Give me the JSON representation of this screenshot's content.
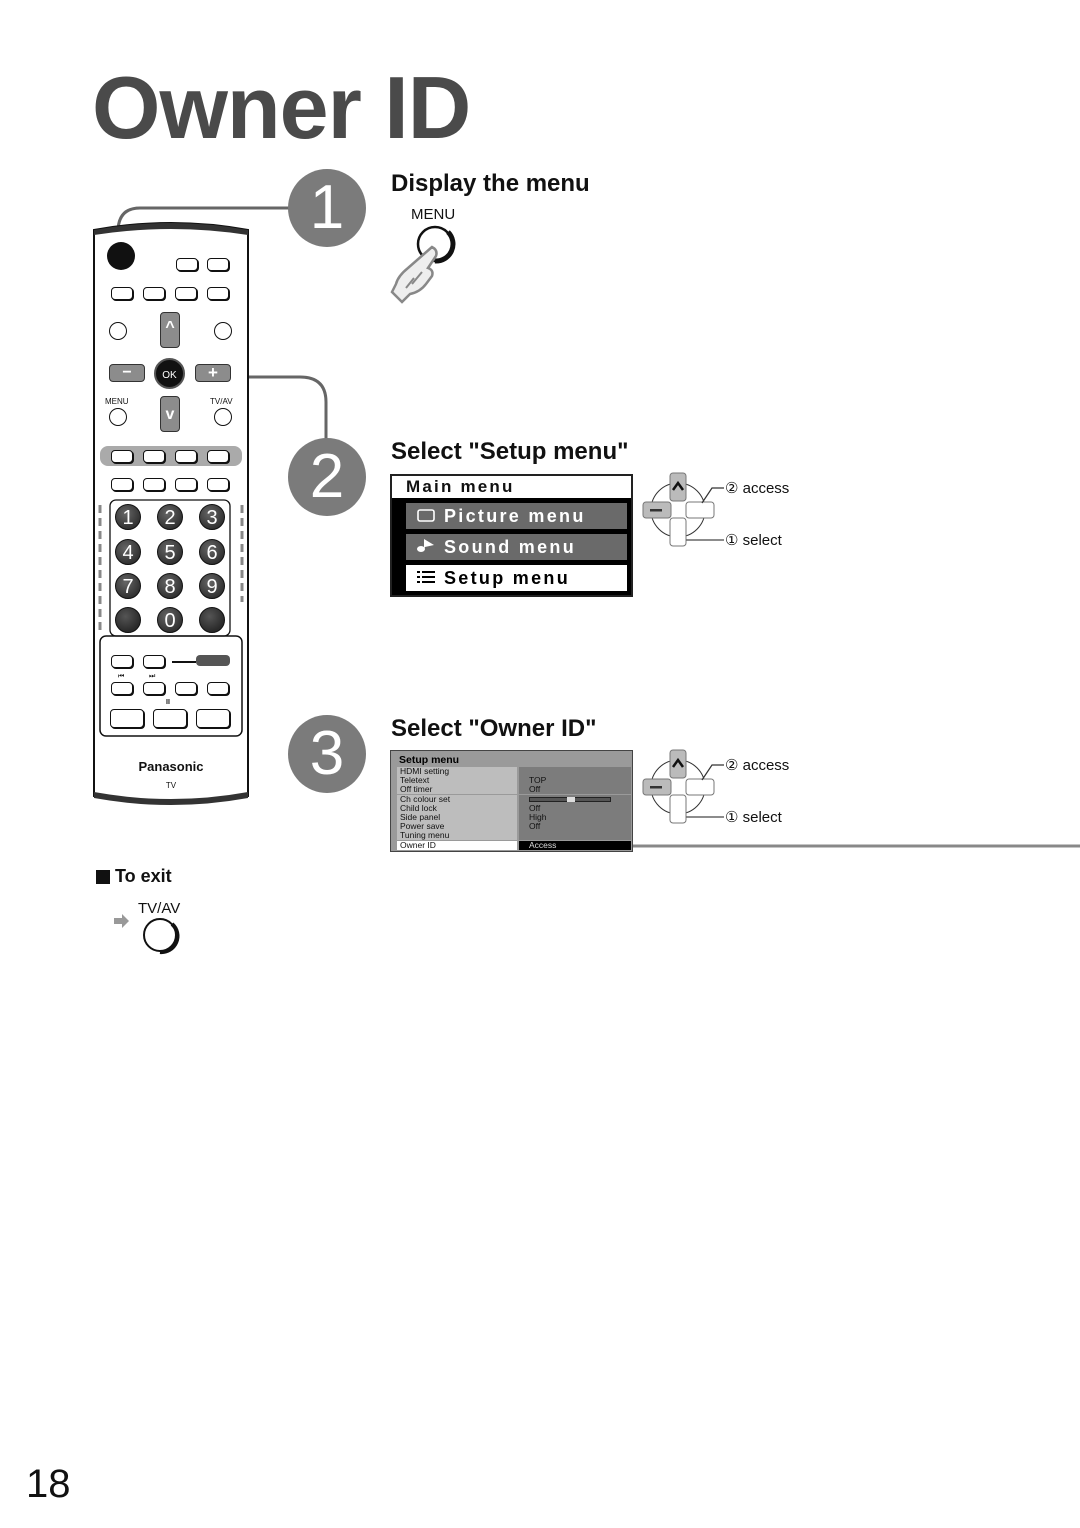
{
  "page": {
    "title": "Owner ID",
    "page_number": "18"
  },
  "steps": [
    {
      "number": "1",
      "title": "Display the menu",
      "button_label": "MENU"
    },
    {
      "number": "2",
      "title": "Select \"Setup menu\"",
      "main_menu": {
        "header": "Main menu",
        "items": [
          {
            "icon": "picture-icon",
            "label": "Picture menu",
            "state": "normal"
          },
          {
            "icon": "sound-icon",
            "label": "Sound menu",
            "state": "normal"
          },
          {
            "icon": "setup-list-icon",
            "label": "Setup menu",
            "state": "highlighted"
          }
        ]
      },
      "dpad": {
        "access_label": "② access",
        "select_label": "① select"
      }
    },
    {
      "number": "3",
      "title": "Select \"Owner ID\"",
      "setup_menu": {
        "header": "Setup menu",
        "rows": [
          {
            "label": "HDMI setting",
            "value": ""
          },
          {
            "label": "Teletext",
            "value": "TOP"
          },
          {
            "label": "Off timer",
            "value": "Off"
          },
          {
            "label": "Ch colour set",
            "value": "",
            "slider": 0.5
          },
          {
            "label": "Child lock",
            "value": "Off"
          },
          {
            "label": "Side panel",
            "value": "High"
          },
          {
            "label": "Power save",
            "value": "Off"
          },
          {
            "label": "Tuning menu",
            "value": ""
          },
          {
            "label": "Owner ID",
            "value": "Access",
            "selected": true
          }
        ]
      },
      "dpad": {
        "access_label": "② access",
        "select_label": "① select"
      }
    }
  ],
  "exit": {
    "heading": "To exit",
    "button_label": "TV/AV"
  },
  "remote": {
    "brand": "Panasonic",
    "model": "TV",
    "menu_label": "MENU",
    "tvav_label": "TV/AV",
    "ok_label": "OK",
    "minus_label": "−",
    "plus_label": "+",
    "up_label": "^",
    "down_label": "v",
    "numbers": [
      "1",
      "2",
      "3",
      "4",
      "5",
      "6",
      "7",
      "8",
      "9",
      "0"
    ],
    "rewind_label": "⏮",
    "forward_label": "⏭",
    "pause_label": "II"
  }
}
